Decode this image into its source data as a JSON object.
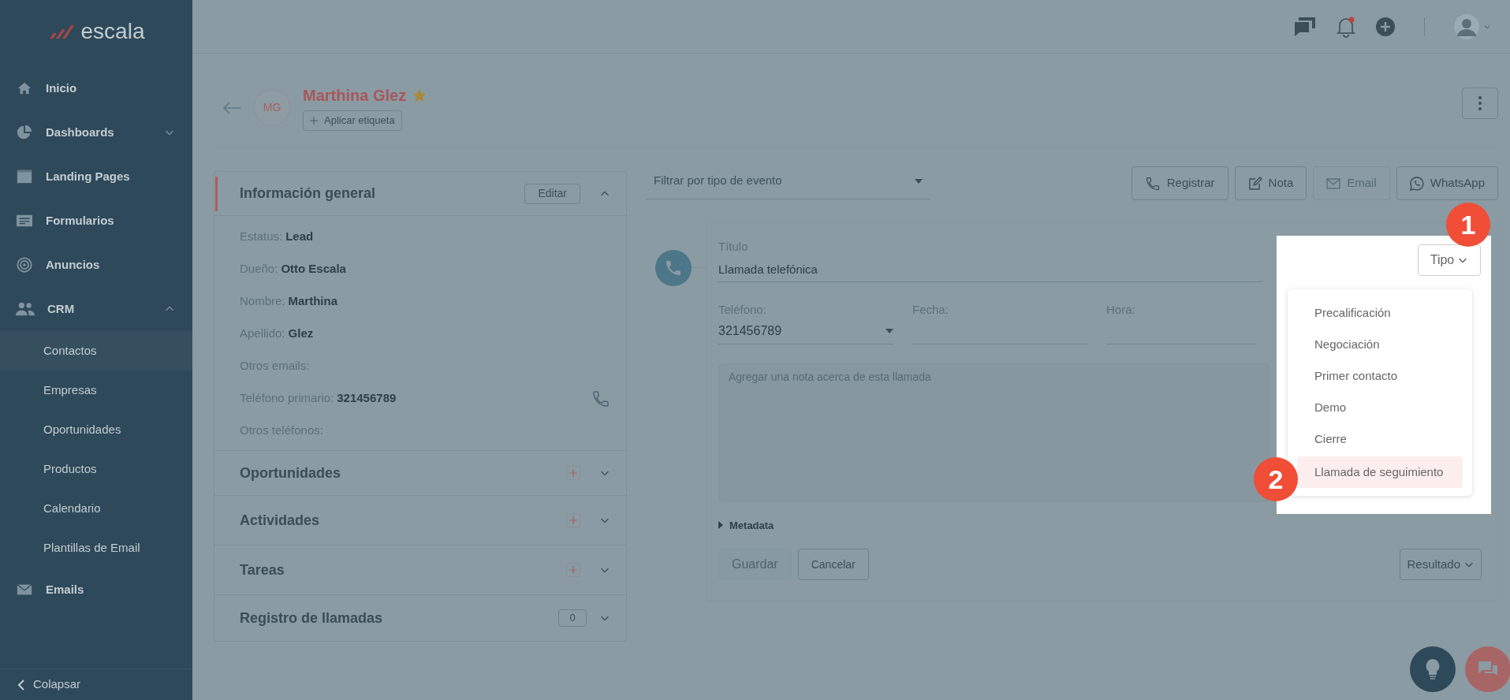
{
  "sidebar": {
    "logo": "escala",
    "items": [
      {
        "label": "Inicio"
      },
      {
        "label": "Dashboards",
        "expanded": false
      },
      {
        "label": "Landing Pages"
      },
      {
        "label": "Formularios"
      },
      {
        "label": "Anuncios"
      },
      {
        "label": "CRM",
        "expanded": true,
        "children": [
          {
            "label": "Contactos",
            "selected": true
          },
          {
            "label": "Empresas",
            "selected": false
          },
          {
            "label": "Oportunidades",
            "selected": false
          },
          {
            "label": "Productos",
            "selected": false
          },
          {
            "label": "Calendario",
            "selected": false
          },
          {
            "label": "Plantillas de Email",
            "selected": false
          }
        ]
      },
      {
        "label": "Emails"
      }
    ],
    "collapse": "Colapsar"
  },
  "contact": {
    "initials": "MG",
    "name": "Marthina Glez",
    "starred": true,
    "tag_button": "Aplicar etiqueta"
  },
  "info_panel": {
    "title": "Información general",
    "edit_button": "Editar",
    "expanded": true,
    "fields": [
      {
        "label": "Estatus:",
        "value": "Lead",
        "kind": "text"
      },
      {
        "label": "Dueño:",
        "value": "Otto Escala",
        "kind": "text"
      },
      {
        "label": "Nombre:",
        "value": "Marthina",
        "kind": "text"
      },
      {
        "label": "Apellido:",
        "value": "Glez",
        "kind": "text"
      },
      {
        "label": "Otros emails:",
        "kind": "text"
      },
      {
        "label": "Teléfono primario:",
        "value": "321456789",
        "kind": "phone"
      },
      {
        "label": "Otros teléfonos:",
        "kind": "text"
      }
    ]
  },
  "sections": [
    {
      "title": "Oportunidades",
      "expanded": false,
      "kind": "add"
    },
    {
      "title": "Actividades",
      "expanded": false,
      "kind": "add"
    },
    {
      "title": "Tareas",
      "expanded": false,
      "kind": "add"
    },
    {
      "title": "Registro de llamadas",
      "expanded": false,
      "kind": "count",
      "count": "0"
    }
  ],
  "timeline": {
    "filter": {
      "placeholder": "Filtrar por tipo de evento"
    },
    "actions": [
      {
        "label": "Registrar",
        "kind": "phone",
        "disabled": false
      },
      {
        "label": "Nota",
        "kind": "note",
        "disabled": false
      },
      {
        "label": "Email",
        "kind": "mail",
        "disabled": true
      },
      {
        "label": "WhatsApp",
        "kind": "whatsapp",
        "disabled": false
      }
    ]
  },
  "call_form": {
    "title_label": "Título",
    "title_value": "Llamada telefónica",
    "type_button": "Tipo",
    "fields": [
      {
        "label": "Teléfono:",
        "value": "321456789",
        "kind": "select"
      },
      {
        "label": "Fecha:",
        "kind": "text"
      },
      {
        "label": "Hora:",
        "kind": "text"
      }
    ],
    "note": {
      "placeholder": "Agregar una nota acerca de esta llamada"
    },
    "metadata": "Metadata",
    "save_button": {
      "label": "Guardar",
      "disabled": true
    },
    "cancel_button": "Cancelar",
    "result_button": "Resultado"
  },
  "type_menu": {
    "items": [
      {
        "label": "Precalificación",
        "selected": false
      },
      {
        "label": "Negociación",
        "selected": false
      },
      {
        "label": "Primer contacto",
        "selected": false
      },
      {
        "label": "Demo",
        "selected": false
      },
      {
        "label": "Cierre",
        "selected": false
      },
      {
        "label": "Llamada de seguimiento",
        "selected": true
      }
    ]
  },
  "callouts": [
    "1",
    "2"
  ]
}
